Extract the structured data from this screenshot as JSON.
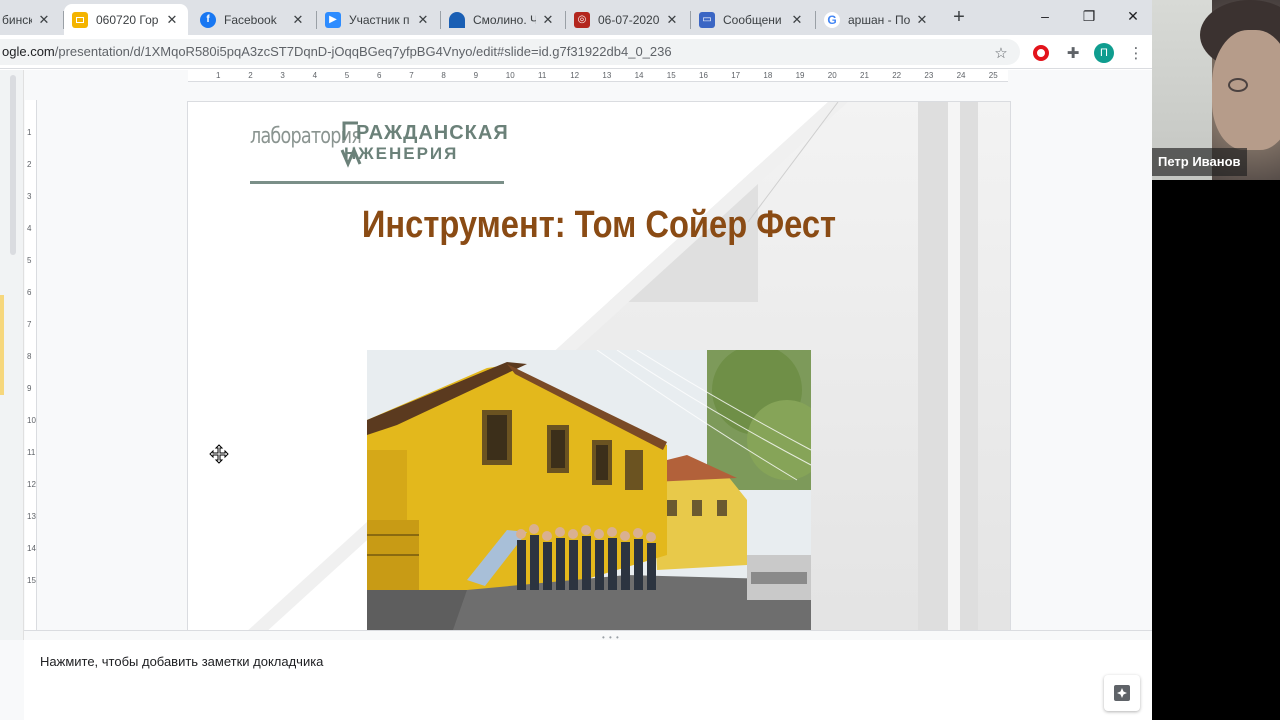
{
  "browser": {
    "tabs": [
      {
        "title": "бинск",
        "favicon": "generic-icon",
        "color": "#9aa0a6"
      },
      {
        "title": "060720 Гор",
        "favicon": "slides-icon",
        "color": "#f4b400",
        "active": true
      },
      {
        "title": "Facebook",
        "favicon": "facebook-icon",
        "color": "#1877f2"
      },
      {
        "title": "Участник п",
        "favicon": "zoom-icon",
        "color": "#2d8cff"
      },
      {
        "title": "Смолино. Ч",
        "favicon": "wave-icon",
        "color": "#1a5fb4"
      },
      {
        "title": "06-07-2020",
        "favicon": "pdf-icon",
        "color": "#b3261e"
      },
      {
        "title": "Сообщени",
        "favicon": "chat-icon",
        "color": "#3b66c4"
      },
      {
        "title": "аршан - По",
        "favicon": "google-icon",
        "color": "#ffffff"
      }
    ],
    "new_tab_symbol": "+",
    "window_controls": {
      "minimize": "–",
      "restore": "❐",
      "close": "✕"
    },
    "url_domain": "ogle.com",
    "url_path": "/presentation/d/1XMqoR580i5pqA3zcST7DqnD-jOqqBGeq7yfpBG4Vnyo/edit#slide=id.g7f31922db4_0_236",
    "profile_initial": "П"
  },
  "ruler": {
    "h_ticks": [
      "1",
      "2",
      "3",
      "4",
      "5",
      "6",
      "7",
      "8",
      "9",
      "10",
      "11",
      "12",
      "13",
      "14",
      "15",
      "16",
      "17",
      "18",
      "19",
      "20",
      "21",
      "22",
      "23",
      "24",
      "25"
    ],
    "v_ticks": [
      "1",
      "2",
      "3",
      "4",
      "5",
      "6",
      "7",
      "8",
      "9",
      "10",
      "11",
      "12",
      "13",
      "14",
      "15"
    ]
  },
  "slide": {
    "logo_left": "лаборатория",
    "logo_line1": "РАЖДАНСКАЯ",
    "logo_line2": "НЖЕНЕРИЯ",
    "title": "Инструмент: Том Сойер Фест"
  },
  "notes": {
    "placeholder": "Нажмите, чтобы добавить заметки докладчика",
    "grip": "• • •"
  },
  "webcam": {
    "participant_name": "Петр Иванов"
  },
  "colors": {
    "title": "#8a4b14",
    "logo": "#6b8179",
    "house_yellow": "#e3b81c"
  }
}
